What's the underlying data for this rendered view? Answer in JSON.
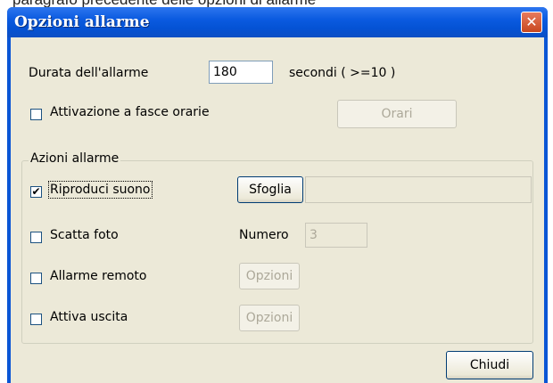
{
  "window": {
    "title": "Opzioni allarme",
    "close_glyph": "✕"
  },
  "background_caption": "paragrafo precedente delle opzioni di allarme",
  "general": {
    "duration_label": "Durata dell'allarme",
    "duration_value": "180",
    "duration_unit": "secondi ( >=10 )",
    "timebands_label": "Attivazione a fasce orarie",
    "timebands_checked": false,
    "timebands_button": "Orari"
  },
  "actions": {
    "group_label": "Azioni allarme",
    "play_sound": {
      "label": "Riproduci suono",
      "checked": true,
      "button": "Sfoglia",
      "path_value": ""
    },
    "take_photo": {
      "label": "Scatta foto",
      "checked": false,
      "count_label": "Numero",
      "count_value": "3"
    },
    "remote_alarm": {
      "label": "Allarme remoto",
      "checked": false,
      "button": "Opzioni"
    },
    "enable_output": {
      "label": "Attiva uscita",
      "checked": false,
      "button": "Opzioni"
    }
  },
  "footer": {
    "close_button": "Chiudi"
  },
  "colors": {
    "titlebar": "#0b5be0",
    "client_bg": "#ece9d8",
    "close_button": "#c8471f"
  },
  "icons": {
    "close": "close-icon",
    "checkmark": "checkmark-icon"
  }
}
